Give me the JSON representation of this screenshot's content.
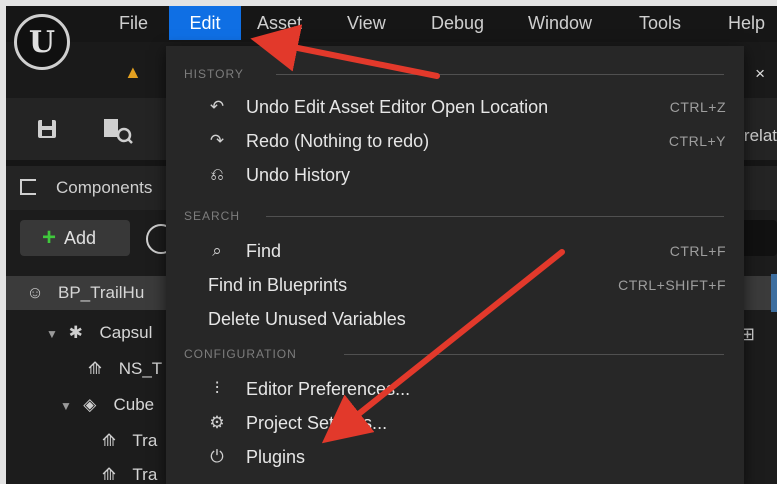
{
  "menubar": {
    "items": [
      "File",
      "Edit",
      "Asset",
      "View",
      "Debug",
      "Window",
      "Tools",
      "Help"
    ],
    "active": "Edit"
  },
  "logo_text": "U",
  "tab": {
    "close": "×"
  },
  "toolbar": {
    "relative_text": "relat"
  },
  "components": {
    "title": "Components",
    "add_label": "Add",
    "tree": [
      {
        "label": "BP_TrailHu",
        "level": 0,
        "icon": "actor-icon"
      },
      {
        "label": "Capsul",
        "level": 1,
        "icon": "capsule-icon",
        "arrow": "▼"
      },
      {
        "label": "NS_T",
        "level": 2,
        "icon": "niagara-icon"
      },
      {
        "label": "Cube",
        "level": 1,
        "icon": "cube-icon",
        "arrow": "▼"
      },
      {
        "label": "Tra",
        "level": 2,
        "icon": "niagara-icon"
      },
      {
        "label": "Tra",
        "level": 2,
        "icon": "niagara-icon"
      }
    ]
  },
  "edit_menu": {
    "sections": [
      {
        "header": "HISTORY",
        "items": [
          {
            "label": "Undo Edit Asset Editor Open Location",
            "shortcut": "CTRL+Z",
            "icon": "undo-icon"
          },
          {
            "label": "Redo (Nothing to redo)",
            "shortcut": "CTRL+Y",
            "icon": "redo-icon"
          },
          {
            "label": "Undo History",
            "shortcut": "",
            "icon": "history-icon"
          }
        ]
      },
      {
        "header": "SEARCH",
        "items": [
          {
            "label": "Find",
            "shortcut": "CTRL+F",
            "icon": "find-icon"
          },
          {
            "label": "Find in Blueprints",
            "shortcut": "CTRL+SHIFT+F",
            "icon": ""
          },
          {
            "label": "Delete Unused Variables",
            "shortcut": "",
            "icon": ""
          }
        ]
      },
      {
        "header": "CONFIGURATION",
        "items": [
          {
            "label": "Editor Preferences...",
            "shortcut": "",
            "icon": "sliders-icon"
          },
          {
            "label": "Project Settings...",
            "shortcut": "",
            "icon": "settings-icon"
          },
          {
            "label": "Plugins",
            "shortcut": "",
            "icon": "plugin-icon"
          }
        ]
      }
    ]
  },
  "colors": {
    "accent": "#0f6fe4",
    "arrow": "#e2392b",
    "menu_bg": "#272727"
  }
}
